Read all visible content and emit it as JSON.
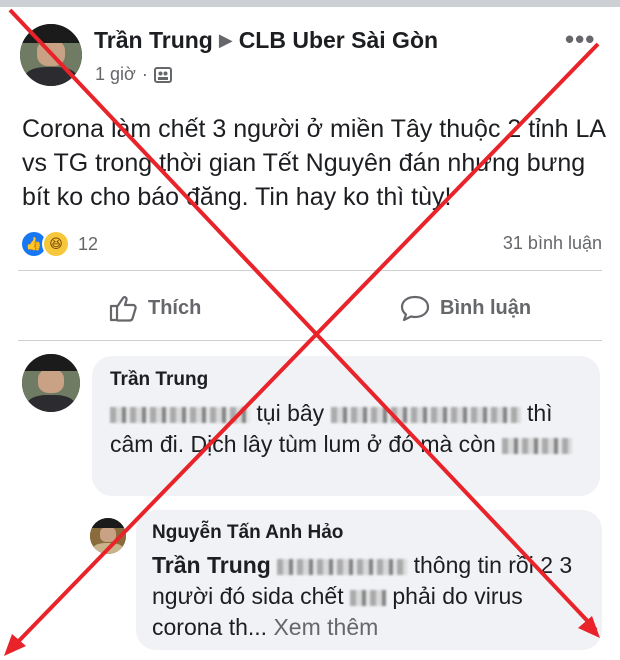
{
  "post": {
    "author": "Trần Trung",
    "group": "CLB Uber Sài Gòn",
    "time": "1 giờ",
    "text": "Corona làm chết 3 người ở miền Tây thuộc 2 tỉnh LA vs TG trong thời gian Tết Nguyên đán nhưng bưng bít ko cho báo đăng. Tin hay ko thì tùy!",
    "reaction_count": "12",
    "comment_count": "31 bình luận"
  },
  "actions": {
    "like_label": "Thích",
    "comment_label": "Bình luận"
  },
  "comments": [
    {
      "name": "Trần Trung",
      "text_part1": "tụi bây",
      "text_part2": "thì câm đi. Dịch lây tùm lum ở đó mà còn"
    },
    {
      "name": "Nguyễn Tấn Anh Hảo",
      "mention": "Trần Trung",
      "text_part1": "thông tin rồi 2 3 người đó sida chết",
      "text_part2": "phải do virus corona th...",
      "see_more": "Xem thêm"
    }
  ],
  "colors": {
    "cross": "#e8232a",
    "bubble": "#f0f2f5",
    "meta": "#65676b"
  }
}
